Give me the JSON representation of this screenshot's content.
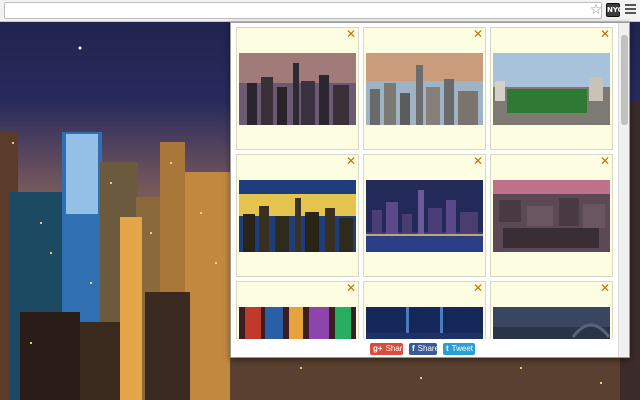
{
  "browser": {
    "icons": {
      "bookmark": "star-icon",
      "extension": "extension-icon",
      "menu": "hamburger-menu-icon"
    },
    "extension_label": "NYC"
  },
  "popup": {
    "remove_icon": "close-x-icon",
    "remove_color": "#d26a00",
    "card_background": "#fdfde2",
    "wallpapers": [
      {
        "scene": "manhattan-sunset-skyline"
      },
      {
        "scene": "midtown-daytime-skyline"
      },
      {
        "scene": "central-park-aerial"
      },
      {
        "scene": "night-skyline-sunburst"
      },
      {
        "scene": "night-skyline-waterfront"
      },
      {
        "scene": "aerial-pink-dusk"
      },
      {
        "scene": "times-square-night"
      },
      {
        "scene": "light-beams-night"
      },
      {
        "scene": "bridge-dusk"
      }
    ],
    "share": [
      {
        "label": "Share",
        "icon": "g+",
        "color": "#dd4b39"
      },
      {
        "label": "Share",
        "icon": "f",
        "color": "#3b5998"
      },
      {
        "label": "Tweet",
        "icon": "t",
        "color": "#2a9fd6"
      }
    ]
  }
}
